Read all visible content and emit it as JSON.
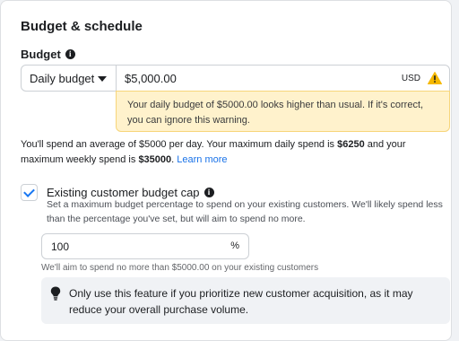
{
  "section": {
    "title": "Budget & schedule",
    "budget_label": "Budget"
  },
  "budget": {
    "type_selected": "Daily budget",
    "amount": "$5,000.00",
    "currency": "USD",
    "warning": "Your daily budget of $5000.00 looks higher than usual. If it's correct, you can ignore this warning."
  },
  "spend_info": {
    "part1": "You'll spend an average of $5000 per day. Your maximum daily spend is ",
    "max_daily": "$6250",
    "part2": " and your maximum weekly spend is ",
    "max_weekly": "$35000",
    "part3": ". ",
    "learn_more": "Learn more"
  },
  "cap": {
    "checked": true,
    "title": "Existing customer budget cap",
    "description": "Set a maximum budget percentage to spend on your existing customers. We'll likely spend less than the percentage you've set, but will aim to spend no more.",
    "value": "100",
    "unit": "%",
    "aim_note": "We'll aim to spend no more than $5000.00 on your existing customers",
    "tip": "Only use this feature if you prioritize new customer acquisition, as it may reduce your overall purchase volume."
  },
  "colors": {
    "accent": "#1877f2",
    "warning_bg": "#fff2cc",
    "warning_icon": "#f5b800",
    "link": "#1a73e8"
  }
}
